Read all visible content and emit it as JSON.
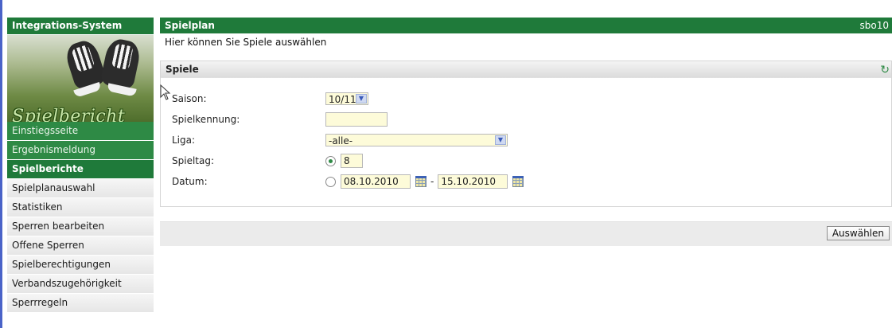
{
  "sidebar": {
    "header": "Integrations-System",
    "banner_text": "Spielbericht",
    "items": [
      {
        "label": "Einstiegsseite",
        "style": "green"
      },
      {
        "label": "Ergebnismeldung",
        "style": "green"
      },
      {
        "label": "Spielberichte",
        "style": "active"
      },
      {
        "label": "Spielplanauswahl",
        "style": "normal"
      },
      {
        "label": "Statistiken",
        "style": "normal"
      },
      {
        "label": "Sperren bearbeiten",
        "style": "normal"
      },
      {
        "label": "Offene Sperren",
        "style": "normal"
      },
      {
        "label": "Spielberechtigungen",
        "style": "normal"
      },
      {
        "label": "Verbandszugehörigkeit",
        "style": "normal"
      },
      {
        "label": "Sperrregeln",
        "style": "normal"
      }
    ]
  },
  "main": {
    "header_title": "Spielplan",
    "user": "sbo10",
    "subtitle": "Hier können Sie Spiele auswählen",
    "panel_title": "Spiele",
    "form": {
      "saison_label": "Saison:",
      "saison_value": "10/11",
      "spielkennung_label": "Spielkennung:",
      "spielkennung_value": "",
      "liga_label": "Liga:",
      "liga_value": "-alle-",
      "spieltag_label": "Spieltag:",
      "spieltag_value": "8",
      "datum_label": "Datum:",
      "datum_from": "08.10.2010",
      "datum_separator": "-",
      "datum_to": "15.10.2010"
    },
    "submit_label": "Auswählen"
  },
  "colors": {
    "header_green": "#1f7a3a",
    "nav_green": "#2e8a45",
    "field_yellow": "#fdfbd9"
  }
}
